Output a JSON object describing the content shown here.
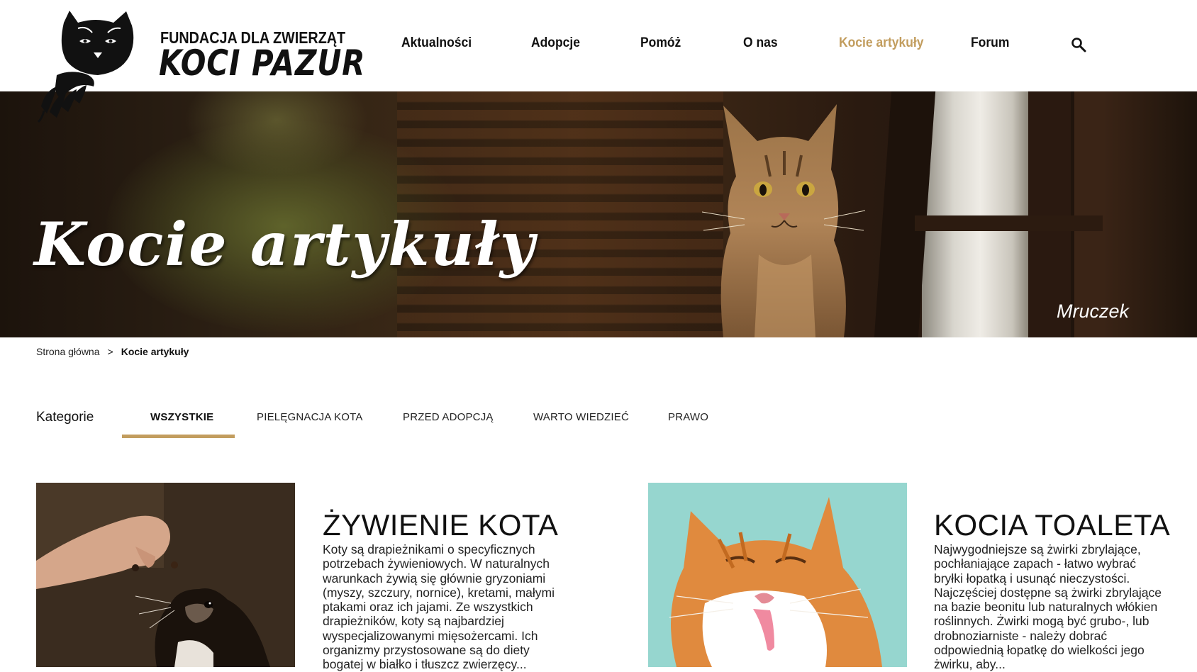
{
  "header": {
    "logo": {
      "line1": "FUNDACJA DLA ZWIERZĄT",
      "line2": "KOCI PAZUR"
    },
    "nav": [
      {
        "label": "Aktualności"
      },
      {
        "label": "Adopcje"
      },
      {
        "label": "Pomóż"
      },
      {
        "label": "O nas"
      },
      {
        "label": "Kocie artykuły",
        "active": true
      },
      {
        "label": "Forum"
      }
    ],
    "search_icon": "search-icon",
    "accent_color": "#c29d5e"
  },
  "hero": {
    "title": "Kocie artykuły",
    "caption": "Mruczek"
  },
  "breadcrumb": {
    "home": "Strona główna",
    "separator": ">",
    "current": "Kocie artykuły"
  },
  "categories": {
    "label": "Kategorie",
    "tabs": [
      {
        "label": "WSZYSTKIE",
        "active": true
      },
      {
        "label": "PIELĘGNACJA KOTA"
      },
      {
        "label": "PRZED ADOPCJĄ"
      },
      {
        "label": "WARTO WIEDZIEĆ"
      },
      {
        "label": "PRAWO"
      }
    ]
  },
  "articles": [
    {
      "title": "ŻYWIENIE KOTA",
      "text": "Koty są drapieżnikami o specyficznych\npotrzebach żywieniowych. W naturalnych\nwarunkach żywią się głównie gryzoniami\n(myszy, szczury, nornice), kretami, małymi\nptakami oraz ich jajami. Ze wszystkich\ndrapieżników, koty są najbardziej\nwyspecjalizowanymi mięsożercami.  Ich\norganizmy przystosowane są do diety\nbogatej w białko i tłuszcz zwierzęcy..."
    },
    {
      "title": "KOCIA TOALETA",
      "text": "Najwygodniejsze są żwirki zbrylające,\npochłaniające zapach - łatwo wybrać\nbryłki łopatką i usunąć nieczystości.\nNajczęściej dostępne są żwirki zbrylające\nna bazie beonitu lub naturalnych włókien\nroślinnych. Żwirki mogą być grubo-, lub\ndrobnoziarniste - należy  dobrać\nodpowiednią łopatkę do wielkości jego\nżwirku, aby..."
    }
  ]
}
